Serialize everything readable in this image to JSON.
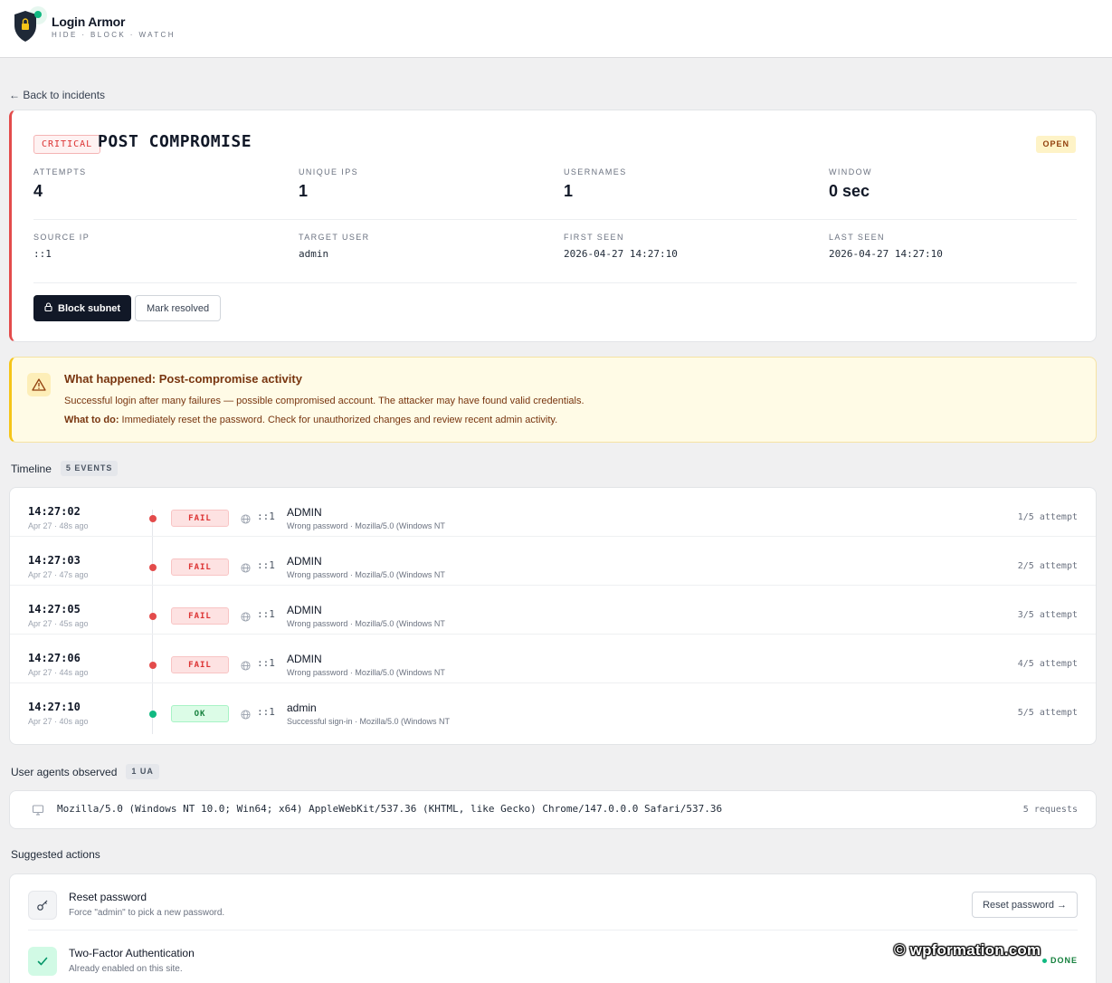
{
  "brand": {
    "title": "Login Armor",
    "tagline": "HIDE · BLOCK · WATCH"
  },
  "nav": {
    "back_label": "← Back to incidents"
  },
  "incident": {
    "severity": "CRITICAL",
    "title": "POST COMPROMISE",
    "status": "OPEN",
    "stats": [
      {
        "label": "ATTEMPTS",
        "value": "4"
      },
      {
        "label": "UNIQUE IPS",
        "value": "1"
      },
      {
        "label": "USERNAMES",
        "value": "1"
      },
      {
        "label": "WINDOW",
        "value": "0 sec"
      }
    ],
    "meta": [
      {
        "label": "SOURCE IP",
        "value": "::1"
      },
      {
        "label": "TARGET USER",
        "value": "admin"
      },
      {
        "label": "FIRST SEEN",
        "value": "2026-04-27 14:27:10"
      },
      {
        "label": "LAST SEEN",
        "value": "2026-04-27 14:27:10"
      }
    ],
    "block_button": "Block subnet",
    "resolve_button": "Mark resolved"
  },
  "alert": {
    "title": "What happened: Post-compromise activity",
    "description": "Successful login after many failures — possible compromised account. The attacker may have found valid credentials.",
    "todo_label": "What to do:",
    "todo_text": " Immediately reset the password. Check for unauthorized changes and review recent admin activity."
  },
  "timeline": {
    "heading": "Timeline",
    "count": "5 EVENTS",
    "events": [
      {
        "time": "14:27:02",
        "ago": "Apr 27 · 48s ago",
        "status": "FAIL",
        "kind": "fail",
        "ip": "::1",
        "user": "ADMIN",
        "detail": "Wrong password · Mozilla/5.0 (Windows NT",
        "attempt": "1/5 attempt"
      },
      {
        "time": "14:27:03",
        "ago": "Apr 27 · 47s ago",
        "status": "FAIL",
        "kind": "fail",
        "ip": "::1",
        "user": "ADMIN",
        "detail": "Wrong password · Mozilla/5.0 (Windows NT",
        "attempt": "2/5 attempt"
      },
      {
        "time": "14:27:05",
        "ago": "Apr 27 · 45s ago",
        "status": "FAIL",
        "kind": "fail",
        "ip": "::1",
        "user": "ADMIN",
        "detail": "Wrong password · Mozilla/5.0 (Windows NT",
        "attempt": "3/5 attempt"
      },
      {
        "time": "14:27:06",
        "ago": "Apr 27 · 44s ago",
        "status": "FAIL",
        "kind": "fail",
        "ip": "::1",
        "user": "ADMIN",
        "detail": "Wrong password · Mozilla/5.0 (Windows NT",
        "attempt": "4/5 attempt"
      },
      {
        "time": "14:27:10",
        "ago": "Apr 27 · 40s ago",
        "status": "OK",
        "kind": "ok",
        "ip": "::1",
        "user": "admin",
        "detail": "Successful sign-in · Mozilla/5.0 (Windows NT",
        "attempt": "5/5 attempt"
      }
    ]
  },
  "user_agents": {
    "heading": "User agents observed",
    "count": "1 UA",
    "items": [
      {
        "ua": "Mozilla/5.0 (Windows NT 10.0; Win64; x64) AppleWebKit/537.36 (KHTML, like Gecko) Chrome/147.0.0.0 Safari/537.36",
        "requests": "5 requests"
      }
    ]
  },
  "suggested": {
    "heading": "Suggested actions",
    "items": [
      {
        "title": "Reset password",
        "subtitle": "Force \"admin\" to pick a new password.",
        "button": "Reset password →"
      },
      {
        "title": "Two-Factor Authentication",
        "subtitle": "Already enabled on this site.",
        "state": "DONE"
      }
    ]
  },
  "watermark": "© wpformation.com",
  "colors": {
    "critical": "#dc3232",
    "ok": "#10b981",
    "dark_button": "#111827",
    "warning_bg": "#fffbe6"
  },
  "icons": {
    "logo": "shield-lock-icon",
    "alert": "warning-triangle-icon",
    "globe": "globe-icon",
    "monitor": "monitor-icon",
    "key": "key-icon",
    "check": "check-icon",
    "lock": "lock-icon"
  }
}
